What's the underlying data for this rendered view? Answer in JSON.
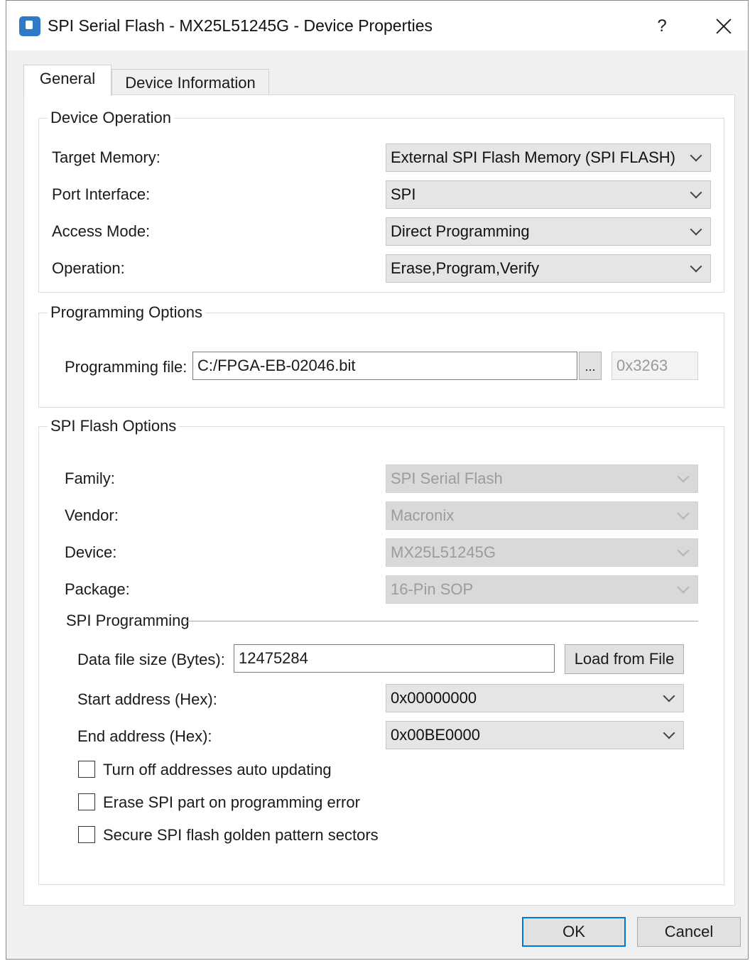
{
  "window": {
    "title": "SPI Serial Flash - MX25L51245G - Device Properties",
    "help_label": "?",
    "icon": "device-icon"
  },
  "tabs": [
    {
      "label": "General",
      "active": true
    },
    {
      "label": "Device Information",
      "active": false
    }
  ],
  "device_operation": {
    "title": "Device Operation",
    "target_memory": {
      "label": "Target Memory:",
      "value": "External SPI Flash Memory (SPI FLASH)"
    },
    "port_interface": {
      "label": "Port Interface:",
      "value": "SPI"
    },
    "access_mode": {
      "label": "Access Mode:",
      "value": "Direct Programming"
    },
    "operation": {
      "label": "Operation:",
      "value": "Erase,Program,Verify"
    }
  },
  "programming_options": {
    "title": "Programming Options",
    "file_label": "Programming file:",
    "file_value": "C:/FPGA-EB-02046.bit",
    "browse_label": "...",
    "checksum": "0x3263"
  },
  "spi_flash_options": {
    "title": "SPI Flash Options",
    "family": {
      "label": "Family:",
      "value": "SPI Serial Flash"
    },
    "vendor": {
      "label": "Vendor:",
      "value": "Macronix"
    },
    "device": {
      "label": "Device:",
      "value": "MX25L51245G"
    },
    "package": {
      "label": "Package:",
      "value": "16-Pin SOP"
    },
    "spi_programming": {
      "title": "SPI Programming",
      "data_size_label": "Data file size (Bytes):",
      "data_size_value": "12475284",
      "load_button": "Load from File",
      "start_label": "Start address (Hex):",
      "start_value": "0x00000000",
      "end_label": "End address (Hex):",
      "end_value": "0x00BE0000",
      "checkboxes": [
        {
          "label": "Turn off addresses auto updating",
          "checked": false
        },
        {
          "label": "Erase SPI part on programming error",
          "checked": false
        },
        {
          "label": "Secure SPI flash golden pattern sectors",
          "checked": false
        }
      ]
    }
  },
  "footer": {
    "ok_label": "OK",
    "cancel_label": "Cancel"
  },
  "colors": {
    "accent": "#0078d7",
    "dialog_bg": "#f0f0f0",
    "disabled_text": "#9c9c9c"
  }
}
